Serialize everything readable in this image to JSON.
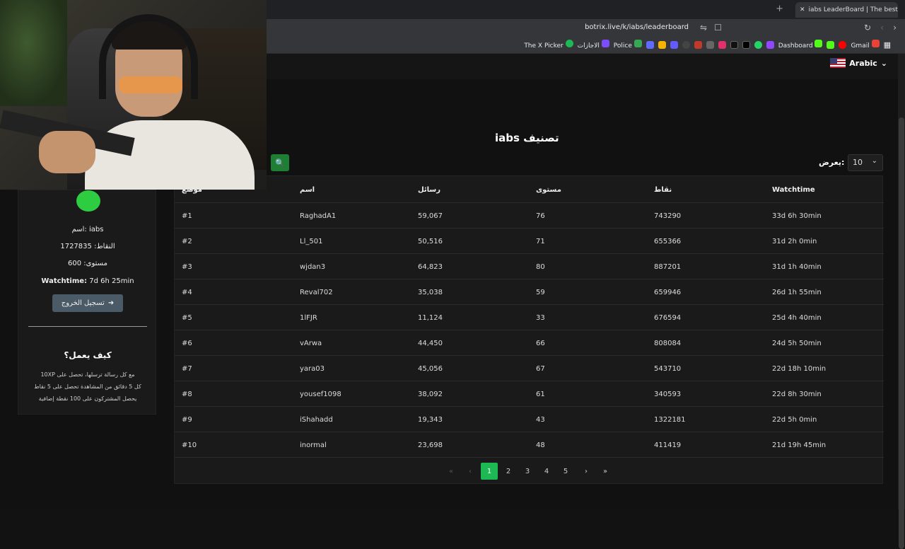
{
  "browser": {
    "tab_title": "iabs LeaderBoard | The best Cha",
    "url": "botrix.live/k/iabs/leaderboard",
    "bookmarks": [
      {
        "label": "Gmail",
        "color": "#ea4335"
      },
      {
        "label": "Dashboard",
        "color": "#53fc18"
      },
      {
        "label": "Police",
        "color": "#34a853"
      },
      {
        "label": "الاجازات",
        "color": "#7c4dff"
      },
      {
        "label": "The X Picker",
        "color": "#1db954"
      }
    ]
  },
  "header": {
    "language": "Arabic"
  },
  "page": {
    "title": "تصنيف iabs",
    "show_label": "يعرض:",
    "show_value": "10"
  },
  "table": {
    "headers": {
      "position": "موضع",
      "name": "اسم",
      "messages": "رسائل",
      "level": "مستوى",
      "points": "نقاط",
      "watchtime": "Watchtime"
    },
    "rows": [
      {
        "pos": "#1",
        "name": "RaghadA1",
        "messages": "59,067",
        "level": "76",
        "points": "743290",
        "watchtime": "33d 6h 30min"
      },
      {
        "pos": "#2",
        "name": "Ll_501",
        "messages": "50,516",
        "level": "71",
        "points": "655366",
        "watchtime": "31d 2h 0min"
      },
      {
        "pos": "#3",
        "name": "wjdan3",
        "messages": "64,823",
        "level": "80",
        "points": "887201",
        "watchtime": "31d 1h 40min"
      },
      {
        "pos": "#4",
        "name": "Reval702",
        "messages": "35,038",
        "level": "59",
        "points": "659946",
        "watchtime": "26d 1h 55min"
      },
      {
        "pos": "#5",
        "name": "1lFJR",
        "messages": "11,124",
        "level": "33",
        "points": "676594",
        "watchtime": "25d 4h 40min"
      },
      {
        "pos": "#6",
        "name": "vArwa",
        "messages": "44,450",
        "level": "66",
        "points": "808084",
        "watchtime": "24d 5h 50min"
      },
      {
        "pos": "#7",
        "name": "yara03",
        "messages": "45,056",
        "level": "67",
        "points": "543710",
        "watchtime": "22d 18h 10min"
      },
      {
        "pos": "#8",
        "name": "yousef1098",
        "messages": "38,092",
        "level": "61",
        "points": "340593",
        "watchtime": "22d 8h 30min"
      },
      {
        "pos": "#9",
        "name": "iShahadd",
        "messages": "19,343",
        "level": "43",
        "points": "1322181",
        "watchtime": "22d 5h 0min"
      },
      {
        "pos": "#10",
        "name": "inormal",
        "messages": "23,698",
        "level": "48",
        "points": "411419",
        "watchtime": "21d 19h 45min"
      }
    ]
  },
  "pagination": {
    "first": "«",
    "prev": "‹",
    "pages": [
      "1",
      "2",
      "3",
      "4",
      "5"
    ],
    "active": "1",
    "next": "›",
    "last": "»"
  },
  "profile": {
    "name_line": "اسم: iabs",
    "points_line": "النقاط: 1727835",
    "level_line": "مستوى: 600",
    "watchtime_label": "Watchtime:",
    "watchtime_value": "7d 6h 25min",
    "logout_label": "تسجيل الخروج",
    "how_title": "كيف يعمل؟",
    "how_lines": [
      "مع كل رسالة ترسلها، تحصل على 10XP",
      "كل 5 دقائق من المشاهدة تحصل على 5 نقاط",
      "يحصل المشتركون على 100 نقطة إضافية"
    ]
  }
}
